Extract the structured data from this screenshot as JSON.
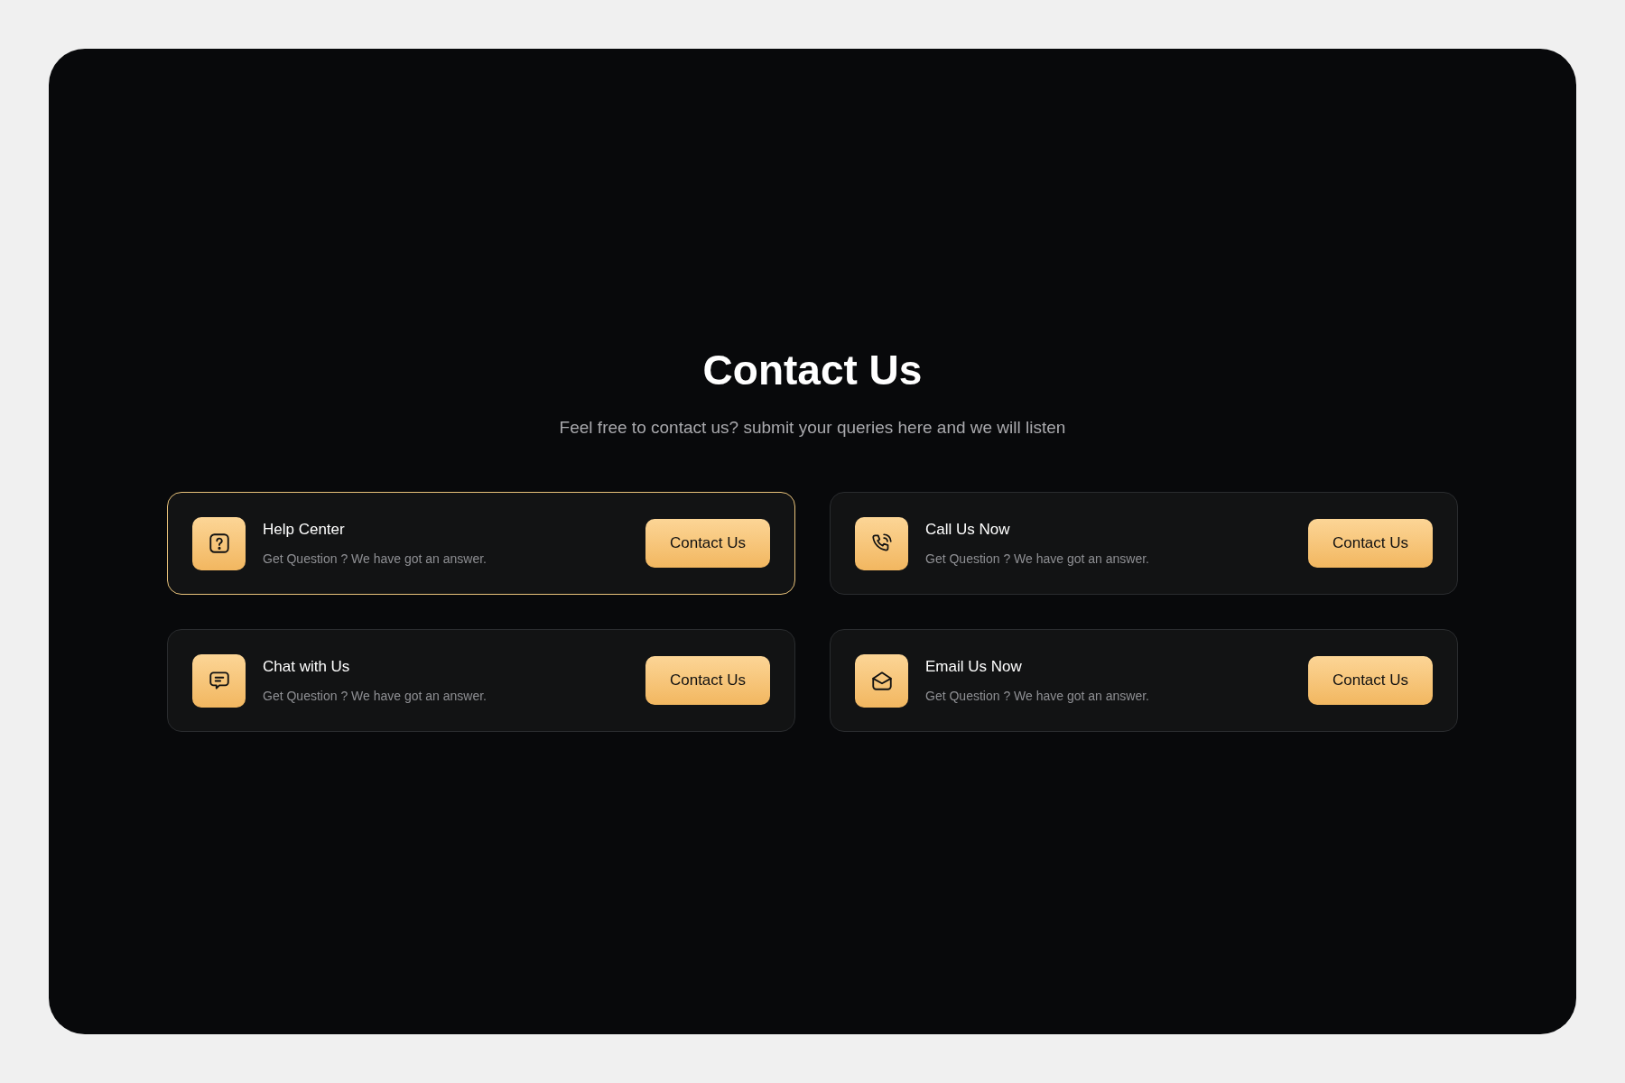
{
  "title": "Contact Us",
  "subtitle": "Feel free to contact us? submit your queries here and we will listen",
  "cards": [
    {
      "kind": "help",
      "title": "Help Center",
      "description": "Get Question ? We have got an answer.",
      "button": "Contact Us",
      "selected": true
    },
    {
      "kind": "phone",
      "title": "Call Us Now",
      "description": "Get Question ? We have got an answer.",
      "button": "Contact Us",
      "selected": false
    },
    {
      "kind": "chat",
      "title": "Chat with Us",
      "description": "Get Question ? We have got an answer.",
      "button": "Contact Us",
      "selected": false
    },
    {
      "kind": "mail",
      "title": "Email Us Now",
      "description": "Get Question ? We have got an answer.",
      "button": "Contact Us",
      "selected": false
    }
  ]
}
